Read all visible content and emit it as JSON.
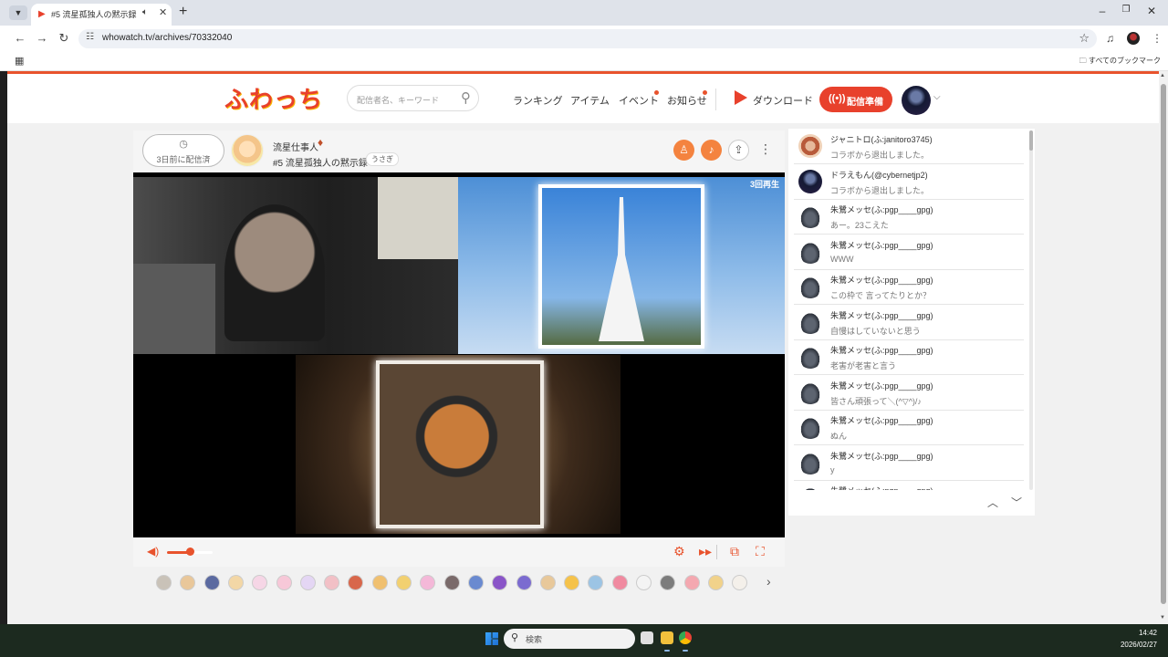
{
  "browser": {
    "tab_title": "#5 流星孤独人の黙示録",
    "url": "whowatch.tv/archives/70332040",
    "all_bookmarks": "すべてのブックマーク",
    "icons": [
      "tab-search-icon",
      "audio-icon",
      "close-icon",
      "new-tab-icon",
      "back-icon",
      "forward-icon",
      "reload-icon",
      "site-info-icon",
      "star-icon",
      "media-icon",
      "profile-icon",
      "menu-icon",
      "apps-icon",
      "folder-icon"
    ]
  },
  "site": {
    "logo": "ふわっち",
    "search_placeholder": "配信者名、キーワード",
    "nav": [
      "ランキング",
      "アイテム",
      "イベント",
      "お知らせ"
    ],
    "download": "ダウンロード",
    "broadcast": "配信準備",
    "accent_color": "#e8412c"
  },
  "player": {
    "history_label": "3日前に配信済",
    "host_name": "流星仕事人",
    "stream_title": "#5 流星孤独人の黙示録",
    "stream_tag": "うさぎ",
    "view_count": "3回再生",
    "volume": 0.5
  },
  "comments": [
    {
      "author": "ジャニトロ(ふ:janitoro3745)",
      "text": "コラボから退出しました。",
      "avatar": "av-1"
    },
    {
      "author": "ドラえもん(@cybernetjp2)",
      "text": "コラボから退出しました。",
      "avatar": "av-2"
    },
    {
      "author": "朱鷺メッセ(ふ:pgp____gpg)",
      "text": "あー。23こえた",
      "avatar": "av-bottle"
    },
    {
      "author": "朱鷺メッセ(ふ:pgp____gpg)",
      "text": "WWW",
      "avatar": "av-bottle"
    },
    {
      "author": "朱鷺メッセ(ふ:pgp____gpg)",
      "text": "この枠で 言ってたりとか？",
      "avatar": "av-bottle"
    },
    {
      "author": "朱鷺メッセ(ふ:pgp____gpg)",
      "text": "自慢はしていないと思う",
      "avatar": "av-bottle"
    },
    {
      "author": "朱鷺メッセ(ふ:pgp____gpg)",
      "text": "老害が老害と言う",
      "avatar": "av-bottle"
    },
    {
      "author": "朱鷺メッセ(ふ:pgp____gpg)",
      "text": "皆さん頑張って＼(^▽^)/♪",
      "avatar": "av-bottle"
    },
    {
      "author": "朱鷺メッセ(ふ:pgp____gpg)",
      "text": "ぬん",
      "avatar": "av-bottle"
    },
    {
      "author": "朱鷺メッセ(ふ:pgp____gpg)",
      "text": "y",
      "avatar": "av-bottle"
    },
    {
      "author": "朱鷺メッセ(ふ:pgp____gpg)",
      "text": "",
      "avatar": "av-bottle"
    }
  ],
  "stamp_colors": [
    "#c9c2b8",
    "#e9c79a",
    "#5b6aa0",
    "#f3d7a6",
    "#f6d6e6",
    "#f7c8d8",
    "#e4d6f4",
    "#f2c0c6",
    "#d8674b",
    "#f0c070",
    "#f2d070",
    "#f4b8d8",
    "#7a6a6a",
    "#6a8ad0",
    "#8a55c8",
    "#7b6bd0",
    "#e8c89a",
    "#f5c24a",
    "#9cc4e4",
    "#f08aa0",
    "#f4f4f4",
    "#7c7c7c",
    "#f4a8b0",
    "#f1d28a",
    "#f4f0ea"
  ],
  "taskbar": {
    "search": "検索",
    "time": "14:42",
    "date": "2026/02/27"
  }
}
